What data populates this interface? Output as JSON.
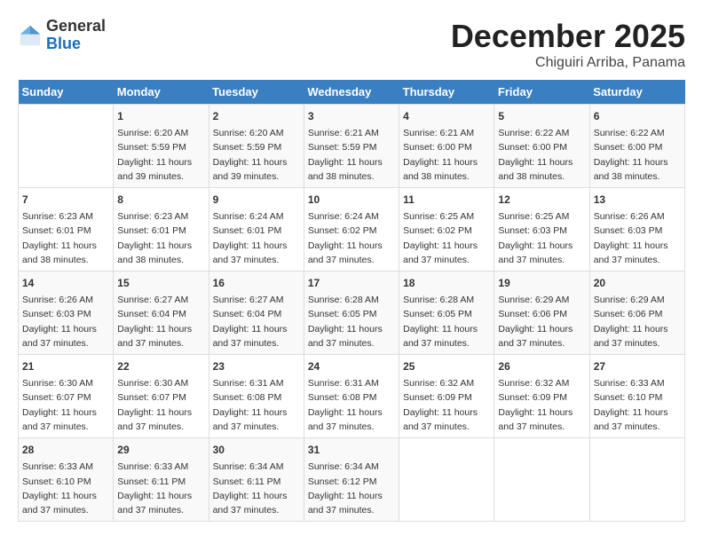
{
  "header": {
    "logo_general": "General",
    "logo_blue": "Blue",
    "month_title": "December 2025",
    "subtitle": "Chiguiri Arriba, Panama"
  },
  "days_of_week": [
    "Sunday",
    "Monday",
    "Tuesday",
    "Wednesday",
    "Thursday",
    "Friday",
    "Saturday"
  ],
  "weeks": [
    [
      {
        "day": "",
        "content": ""
      },
      {
        "day": "1",
        "content": "Sunrise: 6:20 AM\nSunset: 5:59 PM\nDaylight: 11 hours\nand 39 minutes."
      },
      {
        "day": "2",
        "content": "Sunrise: 6:20 AM\nSunset: 5:59 PM\nDaylight: 11 hours\nand 39 minutes."
      },
      {
        "day": "3",
        "content": "Sunrise: 6:21 AM\nSunset: 5:59 PM\nDaylight: 11 hours\nand 38 minutes."
      },
      {
        "day": "4",
        "content": "Sunrise: 6:21 AM\nSunset: 6:00 PM\nDaylight: 11 hours\nand 38 minutes."
      },
      {
        "day": "5",
        "content": "Sunrise: 6:22 AM\nSunset: 6:00 PM\nDaylight: 11 hours\nand 38 minutes."
      },
      {
        "day": "6",
        "content": "Sunrise: 6:22 AM\nSunset: 6:00 PM\nDaylight: 11 hours\nand 38 minutes."
      }
    ],
    [
      {
        "day": "7",
        "content": "Sunrise: 6:23 AM\nSunset: 6:01 PM\nDaylight: 11 hours\nand 38 minutes."
      },
      {
        "day": "8",
        "content": "Sunrise: 6:23 AM\nSunset: 6:01 PM\nDaylight: 11 hours\nand 38 minutes."
      },
      {
        "day": "9",
        "content": "Sunrise: 6:24 AM\nSunset: 6:01 PM\nDaylight: 11 hours\nand 37 minutes."
      },
      {
        "day": "10",
        "content": "Sunrise: 6:24 AM\nSunset: 6:02 PM\nDaylight: 11 hours\nand 37 minutes."
      },
      {
        "day": "11",
        "content": "Sunrise: 6:25 AM\nSunset: 6:02 PM\nDaylight: 11 hours\nand 37 minutes."
      },
      {
        "day": "12",
        "content": "Sunrise: 6:25 AM\nSunset: 6:03 PM\nDaylight: 11 hours\nand 37 minutes."
      },
      {
        "day": "13",
        "content": "Sunrise: 6:26 AM\nSunset: 6:03 PM\nDaylight: 11 hours\nand 37 minutes."
      }
    ],
    [
      {
        "day": "14",
        "content": "Sunrise: 6:26 AM\nSunset: 6:03 PM\nDaylight: 11 hours\nand 37 minutes."
      },
      {
        "day": "15",
        "content": "Sunrise: 6:27 AM\nSunset: 6:04 PM\nDaylight: 11 hours\nand 37 minutes."
      },
      {
        "day": "16",
        "content": "Sunrise: 6:27 AM\nSunset: 6:04 PM\nDaylight: 11 hours\nand 37 minutes."
      },
      {
        "day": "17",
        "content": "Sunrise: 6:28 AM\nSunset: 6:05 PM\nDaylight: 11 hours\nand 37 minutes."
      },
      {
        "day": "18",
        "content": "Sunrise: 6:28 AM\nSunset: 6:05 PM\nDaylight: 11 hours\nand 37 minutes."
      },
      {
        "day": "19",
        "content": "Sunrise: 6:29 AM\nSunset: 6:06 PM\nDaylight: 11 hours\nand 37 minutes."
      },
      {
        "day": "20",
        "content": "Sunrise: 6:29 AM\nSunset: 6:06 PM\nDaylight: 11 hours\nand 37 minutes."
      }
    ],
    [
      {
        "day": "21",
        "content": "Sunrise: 6:30 AM\nSunset: 6:07 PM\nDaylight: 11 hours\nand 37 minutes."
      },
      {
        "day": "22",
        "content": "Sunrise: 6:30 AM\nSunset: 6:07 PM\nDaylight: 11 hours\nand 37 minutes."
      },
      {
        "day": "23",
        "content": "Sunrise: 6:31 AM\nSunset: 6:08 PM\nDaylight: 11 hours\nand 37 minutes."
      },
      {
        "day": "24",
        "content": "Sunrise: 6:31 AM\nSunset: 6:08 PM\nDaylight: 11 hours\nand 37 minutes."
      },
      {
        "day": "25",
        "content": "Sunrise: 6:32 AM\nSunset: 6:09 PM\nDaylight: 11 hours\nand 37 minutes."
      },
      {
        "day": "26",
        "content": "Sunrise: 6:32 AM\nSunset: 6:09 PM\nDaylight: 11 hours\nand 37 minutes."
      },
      {
        "day": "27",
        "content": "Sunrise: 6:33 AM\nSunset: 6:10 PM\nDaylight: 11 hours\nand 37 minutes."
      }
    ],
    [
      {
        "day": "28",
        "content": "Sunrise: 6:33 AM\nSunset: 6:10 PM\nDaylight: 11 hours\nand 37 minutes."
      },
      {
        "day": "29",
        "content": "Sunrise: 6:33 AM\nSunset: 6:11 PM\nDaylight: 11 hours\nand 37 minutes."
      },
      {
        "day": "30",
        "content": "Sunrise: 6:34 AM\nSunset: 6:11 PM\nDaylight: 11 hours\nand 37 minutes."
      },
      {
        "day": "31",
        "content": "Sunrise: 6:34 AM\nSunset: 6:12 PM\nDaylight: 11 hours\nand 37 minutes."
      },
      {
        "day": "",
        "content": ""
      },
      {
        "day": "",
        "content": ""
      },
      {
        "day": "",
        "content": ""
      }
    ]
  ]
}
